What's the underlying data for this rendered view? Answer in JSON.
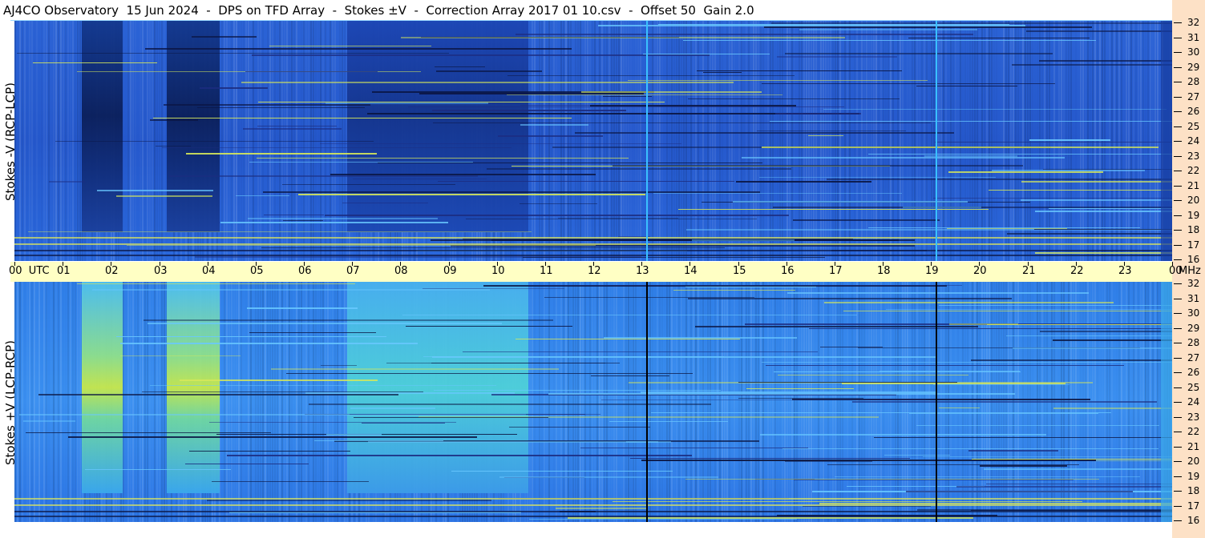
{
  "header": {
    "title": "AJ4CO Observatory  15 Jun 2024  -  DPS on TFD Array  -  Stokes ±V  -  Correction Array 2017 01 10.csv  -  Offset 50  Gain 2.0"
  },
  "panels": {
    "top_label": "Stokes -V (RCP-LCP)",
    "bottom_label": "Stokes +V (LCP-RCP)"
  },
  "time_axis": {
    "labels": [
      "00  UTC",
      "01",
      "02",
      "03",
      "04",
      "05",
      "06",
      "07",
      "08",
      "09",
      "10",
      "11",
      "12",
      "13",
      "14",
      "15",
      "16",
      "17",
      "18",
      "19",
      "20",
      "21",
      "22",
      "23",
      "00"
    ]
  },
  "freq_axis": {
    "unit": "MHz",
    "labels": [
      "32",
      "31",
      "30",
      "29",
      "28",
      "27",
      "26",
      "25",
      "24",
      "23",
      "22",
      "21",
      "20",
      "19",
      "18",
      "17",
      "16"
    ]
  },
  "colors": {
    "background_blue": "#2a6ae0",
    "dark_band": "#10307a",
    "bright_band": "#d8e846",
    "timebar": "#ffffc4",
    "freq_strip": "#fde1c6"
  },
  "chart_data": [
    {
      "type": "heatmap",
      "title": "Stokes -V (RCP-LCP)",
      "x_range_utc_hours": [
        0,
        24
      ],
      "y_range_mhz": [
        16,
        32
      ],
      "features": [
        {
          "kind": "dark_block",
          "utc": [
            1.4,
            2.25
          ]
        },
        {
          "kind": "dark_block",
          "utc": [
            3.15,
            4.25
          ]
        },
        {
          "kind": "dim_block",
          "utc": [
            6.9,
            10.65
          ]
        },
        {
          "kind": "vertical_line",
          "utc": 13.1,
          "color": "#3ac0ff"
        },
        {
          "kind": "vertical_line",
          "utc": 19.1,
          "color": "#3ac0ff"
        }
      ]
    },
    {
      "type": "heatmap",
      "title": "Stokes +V (LCP-RCP)",
      "x_range_utc_hours": [
        0,
        24
      ],
      "y_range_mhz": [
        16,
        32
      ],
      "features": [
        {
          "kind": "bright_block",
          "utc": [
            1.4,
            2.25
          ]
        },
        {
          "kind": "bright_block",
          "utc": [
            3.15,
            4.25
          ]
        },
        {
          "kind": "bright_block",
          "utc": [
            6.9,
            10.65
          ]
        },
        {
          "kind": "vertical_line",
          "utc": 13.1,
          "color": "#000000"
        },
        {
          "kind": "vertical_line",
          "utc": 19.1,
          "color": "#000000"
        }
      ]
    }
  ]
}
